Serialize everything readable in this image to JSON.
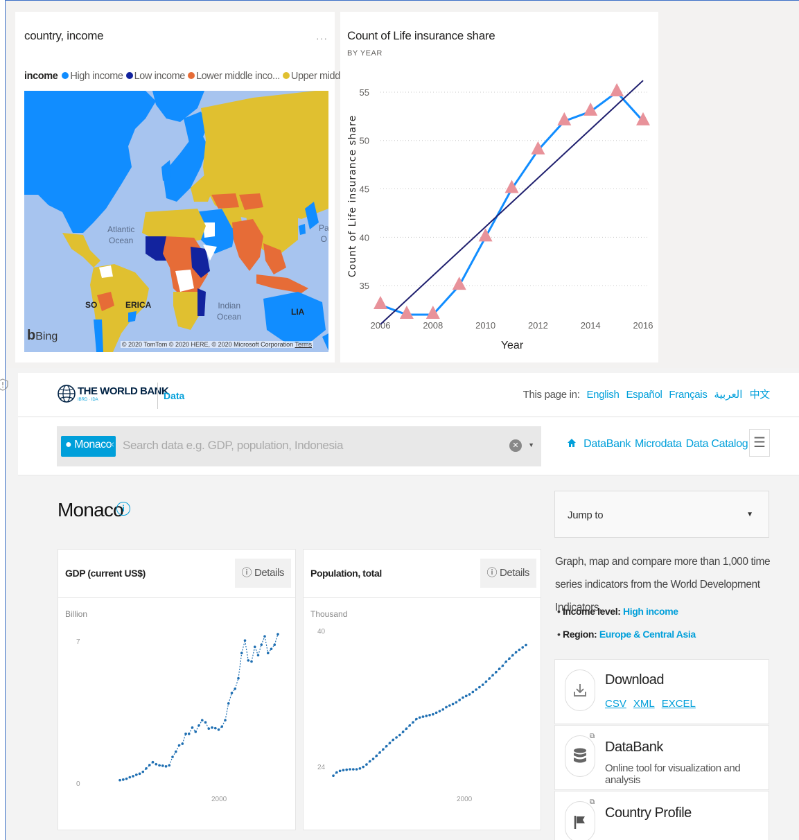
{
  "map_card": {
    "title": "country, income",
    "more": "···",
    "legend_title": "income",
    "legend": [
      {
        "label": "High income",
        "color": "#118dff"
      },
      {
        "label": "Low income",
        "color": "#12239e"
      },
      {
        "label": "Lower middle inco...",
        "color": "#e66c37"
      },
      {
        "label": "Upper middle i...",
        "color": "#e0c030"
      }
    ],
    "labels": {
      "atlantic": "Atlantic\nOcean",
      "indian": "Indian\nOcean",
      "south_america": "SO",
      "america_tail": "ERICA",
      "lia": "LIA",
      "pacific": "Pa\nO"
    },
    "bing": "Bing",
    "copyright": "© 2020 TomTom © 2020 HERE, © 2020 Microsoft Corporation",
    "terms": "Terms"
  },
  "line_card": {
    "title": "Count of Life insurance share",
    "subtitle": "BY YEAR",
    "chart_data": {
      "type": "line",
      "title": "Count of Life insurance share",
      "subtitle": "BY YEAR",
      "xlabel": "Year",
      "ylabel": "Count of Life insurance share",
      "x": [
        2006,
        2007,
        2008,
        2009,
        2010,
        2011,
        2012,
        2013,
        2014,
        2015,
        2016
      ],
      "series": [
        {
          "values": [
            33,
            32,
            32,
            35,
            40,
            45,
            49,
            52,
            53,
            55,
            52
          ]
        }
      ],
      "trend_line": {
        "start": [
          2006,
          31
        ],
        "end": [
          2016,
          56.2
        ]
      },
      "x_ticks": [
        "2006",
        "2008",
        "2010",
        "2012",
        "2014",
        "2016"
      ],
      "y_ticks": [
        "35",
        "40",
        "45",
        "50",
        "55"
      ],
      "xlim": [
        2006,
        2016
      ],
      "ylim": [
        32,
        56.5
      ],
      "grid": true,
      "colors": {
        "line": "#118dff",
        "marker": "#e8929a",
        "trend": "#1f1f6e"
      }
    }
  },
  "worldbank": {
    "logo_text": "THE WORLD BANK",
    "logo_sub": "IBRD · IDA",
    "data_link": "Data",
    "langs_prefix": "This page in:",
    "langs": [
      "English",
      "Español",
      "Français",
      "العربية",
      "中文"
    ],
    "search": {
      "chip": "Monaco",
      "chip_x": "×",
      "placeholder": "Search data e.g. GDP, population, Indonesia"
    },
    "nav": [
      "DataBank",
      "Microdata",
      "Data Catalog"
    ],
    "country": "Monaco",
    "gdp_panel": {
      "title": "GDP (current US$)",
      "details": "Details",
      "unit": "Billion",
      "y_top": "7",
      "y_bottom": "0",
      "x_tick": "2000",
      "chart_data": {
        "type": "line",
        "title": "GDP (current US$)",
        "ylabel": "Billion",
        "x": [
          1970,
          1971,
          1972,
          1973,
          1974,
          1975,
          1976,
          1977,
          1978,
          1979,
          1980,
          1981,
          1982,
          1983,
          1984,
          1985,
          1986,
          1987,
          1988,
          1989,
          1990,
          1991,
          1992,
          1993,
          1994,
          1995,
          1996,
          1997,
          1998,
          1999,
          2000,
          2001,
          2002,
          2003,
          2004,
          2005,
          2006,
          2007,
          2008,
          2009,
          2010,
          2011,
          2012,
          2013,
          2014,
          2015,
          2016,
          2017,
          2018
        ],
        "values": [
          0.24,
          0.27,
          0.31,
          0.38,
          0.43,
          0.5,
          0.55,
          0.64,
          0.8,
          0.96,
          1.1,
          1.0,
          0.95,
          0.93,
          0.9,
          0.95,
          1.35,
          1.6,
          1.9,
          1.98,
          2.45,
          2.45,
          2.75,
          2.55,
          2.85,
          3.1,
          3.0,
          2.7,
          2.75,
          2.72,
          2.65,
          2.8,
          3.1,
          3.9,
          4.4,
          4.6,
          5.1,
          6.3,
          6.9,
          5.95,
          5.9,
          6.6,
          6.2,
          6.7,
          7.1,
          6.3,
          6.5,
          6.7,
          7.2
        ],
        "ylim": [
          0,
          7.6
        ],
        "color": "#1f6fb2"
      }
    },
    "pop_panel": {
      "title": "Population, total",
      "details": "Details",
      "unit": "Thousand",
      "y_top": "40",
      "y_bottom": "24",
      "x_tick": "2000",
      "chart_data": {
        "type": "line",
        "title": "Population, total",
        "ylabel": "Thousand",
        "x": [
          1960,
          1961,
          1962,
          1963,
          1964,
          1965,
          1966,
          1967,
          1968,
          1969,
          1970,
          1971,
          1972,
          1973,
          1974,
          1975,
          1976,
          1977,
          1978,
          1979,
          1980,
          1981,
          1982,
          1983,
          1984,
          1985,
          1986,
          1987,
          1988,
          1989,
          1990,
          1991,
          1992,
          1993,
          1994,
          1995,
          1996,
          1997,
          1998,
          1999,
          2000,
          2001,
          2002,
          2003,
          2004,
          2005,
          2006,
          2007,
          2008,
          2009,
          2010,
          2011,
          2012,
          2013,
          2014,
          2015,
          2016,
          2017,
          2018
        ],
        "values": [
          22.2,
          22.6,
          22.8,
          22.9,
          22.95,
          23.0,
          23.0,
          23.0,
          23.1,
          23.3,
          23.6,
          24.0,
          24.3,
          24.7,
          25.1,
          25.5,
          25.9,
          26.3,
          26.7,
          27.0,
          27.3,
          27.7,
          28.1,
          28.5,
          28.9,
          29.3,
          29.5,
          29.6,
          29.7,
          29.8,
          29.9,
          30.1,
          30.3,
          30.5,
          30.8,
          31.0,
          31.2,
          31.4,
          31.7,
          32.0,
          32.2,
          32.4,
          32.7,
          33.0,
          33.3,
          33.6,
          34.0,
          34.4,
          34.8,
          35.2,
          35.6,
          36.0,
          36.5,
          36.9,
          37.3,
          37.7,
          38.0,
          38.3,
          38.6
        ],
        "ylim": [
          21,
          41
        ],
        "color": "#1f6fb2"
      }
    },
    "jump_to": "Jump to",
    "description": "Graph, map and compare more than 1,000 time series indicators from the World Development Indicators.",
    "income_label": "Income level:",
    "income_value": "High income",
    "region_label": "Region:",
    "region_value": "Europe & Central Asia",
    "download": {
      "title": "Download",
      "links": [
        "CSV",
        "XML",
        "EXCEL"
      ]
    },
    "databank": {
      "title": "DataBank",
      "sub": "Online tool for visualization and analysis"
    },
    "profile": {
      "title": "Country Profile"
    }
  }
}
